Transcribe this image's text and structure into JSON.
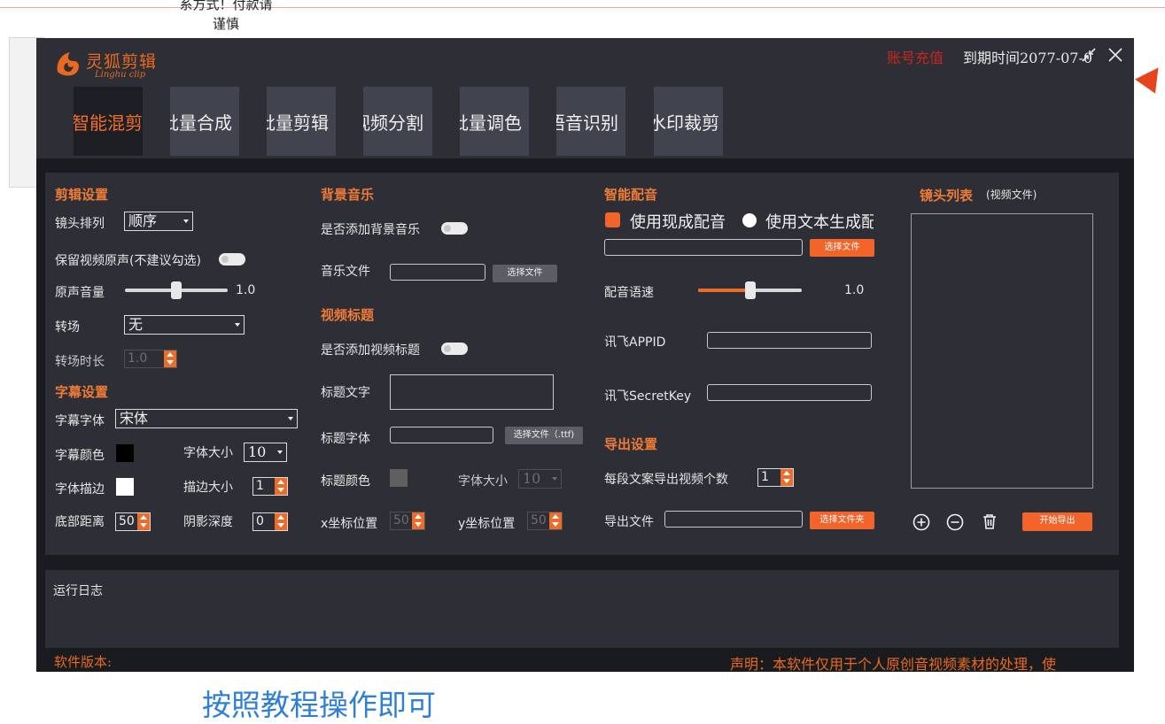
{
  "overlay": {
    "top_note_line1": "系方式！付款请",
    "top_note_line2": "谨慎",
    "caption": "按照教程操作即可"
  },
  "app": {
    "logo_title": "灵狐剪辑",
    "logo_subtitle": "Linghu clip",
    "recharge": "账号充值",
    "expire": "到期时间2077-07-0",
    "tabs": [
      {
        "label": "智能混剪",
        "active": true
      },
      {
        "label": "批量合成"
      },
      {
        "label": "批量剪辑"
      },
      {
        "label": "视频分割"
      },
      {
        "label": "批量调色"
      },
      {
        "label": "语音识别"
      },
      {
        "label": "去水印裁剪"
      }
    ]
  },
  "edit": {
    "title": "剪辑设置",
    "shot_order_label": "镜头排列",
    "shot_order_value": "顺序",
    "keep_audio_label": "保留视频原声(不建议勾选)",
    "orig_volume_label": "原声音量",
    "orig_volume_value": "1.0",
    "orig_volume_level": 0.5,
    "transition_label": "转场",
    "transition_value": "无",
    "transition_dur_label": "转场时长",
    "transition_dur_value": "1.0"
  },
  "subtitle": {
    "title": "字幕设置",
    "font_label": "字幕字体",
    "font_value": "宋体",
    "color_label": "字幕颜色",
    "color": "#000000",
    "size_label": "字体大小",
    "size_value": "10",
    "stroke_label": "字体描边",
    "stroke_color": "#ffffff",
    "stroke_size_label": "描边大小",
    "stroke_size_value": "1",
    "bottom_label": "底部距离",
    "bottom_value": "50",
    "shadow_label": "阴影深度",
    "shadow_value": "0"
  },
  "music": {
    "title": "背景音乐",
    "add_label": "是否添加背景音乐",
    "file_label": "音乐文件",
    "file_value": "",
    "choose_btn": "选择文件"
  },
  "video_title": {
    "title": "视频标题",
    "add_label": "是否添加视频标题",
    "text_label": "标题文字",
    "font_label": "标题字体",
    "font_btn": "选择文件（.ttf)",
    "color_label": "标题颜色",
    "color": "#5f5f5f",
    "size_label": "字体大小",
    "size_value": "10",
    "x_label": "x坐标位置",
    "x_value": "50",
    "y_label": "y坐标位置",
    "y_value": "50"
  },
  "dubbing": {
    "title": "智能配音",
    "opt_existing": "使用现成配音",
    "opt_generate": "使用文本生成配音",
    "choose_btn": "选择文件",
    "speed_label": "配音语速",
    "speed_value": "1.0",
    "speed_level": 0.5,
    "appid_label": "讯飞APPID",
    "secret_label": "讯飞SecretKey"
  },
  "export": {
    "title": "导出设置",
    "count_label": "每段文案导出视频个数",
    "count_value": "1",
    "file_label": "导出文件",
    "choose_btn": "选择文件夹"
  },
  "shotlist": {
    "title": "镜头列表",
    "subtitle": "(视频文件)",
    "start_btn": "开始导出"
  },
  "log": {
    "title": "运行日志"
  },
  "footer": {
    "version_label": "软件版本:",
    "disclaimer": "声明：本软件仅用于个人原创音视频素材的处理，使"
  },
  "colors": {
    "accent": "#f2642a",
    "window_bg": "#2e2f36"
  }
}
